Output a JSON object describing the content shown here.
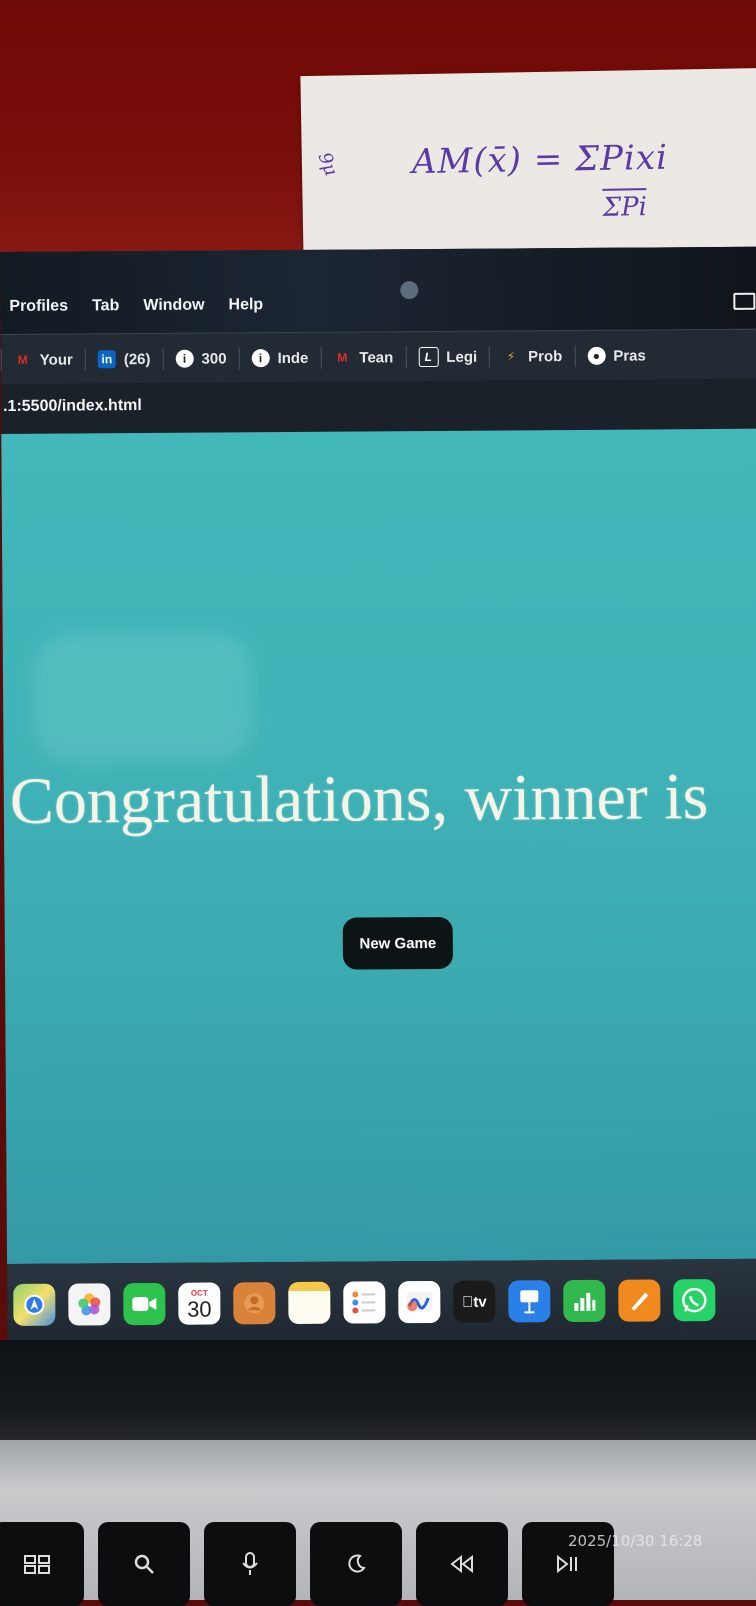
{
  "note": {
    "formula": "AM(x̄) = ΣPixi",
    "denominator": "ΣPi",
    "side": "9μ"
  },
  "menubar": {
    "items": [
      "Profiles",
      "Tab",
      "Window",
      "Help"
    ]
  },
  "bookmarks": [
    {
      "icon": "gmail-icon",
      "label": "Your",
      "color": "#d93025"
    },
    {
      "icon": "linkedin-icon",
      "label": "(26)",
      "color": "#0a66c2"
    },
    {
      "icon": "info-icon",
      "label": "300",
      "color": "#ffffff"
    },
    {
      "icon": "info-icon",
      "label": "Inde",
      "color": "#ffffff"
    },
    {
      "icon": "gmail-icon",
      "label": "Tean",
      "color": "#d93025"
    },
    {
      "icon": "legislation-icon",
      "label": "Legi",
      "color": "#ffffff"
    },
    {
      "icon": "problem-icon",
      "label": "Prob",
      "color": "#f2a33a"
    },
    {
      "icon": "github-icon",
      "label": "Pras",
      "color": "#ffffff"
    }
  ],
  "url": ".1:5500/index.html",
  "page": {
    "headline": "Congratulations, winner is",
    "button": "New Game",
    "background": "#3fb3b7"
  },
  "dock": {
    "apps": [
      {
        "name": "maps-icon",
        "bg": "#4a8ee6",
        "label": ""
      },
      {
        "name": "photos-icon",
        "bg": "#f4f4f4",
        "label": ""
      },
      {
        "name": "facetime-icon",
        "bg": "#2dc24b",
        "label": ""
      },
      {
        "name": "calendar-icon",
        "bg": "#ffffff",
        "label": "30",
        "month": "OCT"
      },
      {
        "name": "contacts-icon",
        "bg": "#d9823a",
        "label": ""
      },
      {
        "name": "notes-icon",
        "bg": "#fbf4d8",
        "label": ""
      },
      {
        "name": "reminders-icon",
        "bg": "#ffffff",
        "label": ""
      },
      {
        "name": "freeform-icon",
        "bg": "#ffffff",
        "label": ""
      },
      {
        "name": "appletv-icon",
        "bg": "#1a1a1a",
        "label": "tv"
      },
      {
        "name": "keynote-icon",
        "bg": "#2a7fe8",
        "label": ""
      },
      {
        "name": "numbers-icon",
        "bg": "#31b94e",
        "label": ""
      },
      {
        "name": "pages-icon",
        "bg": "#f18a1e",
        "label": ""
      },
      {
        "name": "whatsapp-icon",
        "bg": "#25d366",
        "label": ""
      }
    ]
  },
  "keys": [
    "F3",
    "search",
    "mic",
    "moon",
    "rewind",
    "play-pause"
  ],
  "timestamp": "2025/10/30 16:28"
}
